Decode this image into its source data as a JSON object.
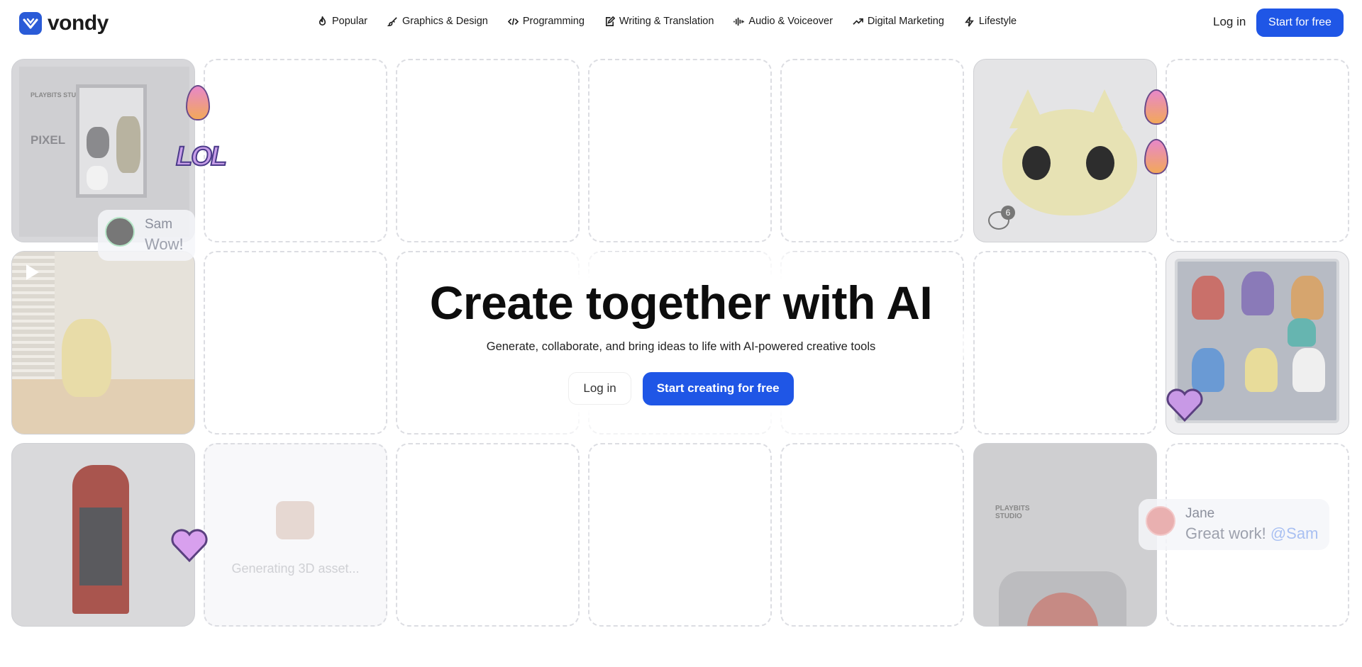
{
  "brand": {
    "name": "vondy",
    "accent": "#1f56e6"
  },
  "nav": [
    {
      "label": "Popular",
      "icon": "flame-icon"
    },
    {
      "label": "Graphics & Design",
      "icon": "brush-icon"
    },
    {
      "label": "Programming",
      "icon": "code-icon"
    },
    {
      "label": "Writing & Translation",
      "icon": "edit-icon"
    },
    {
      "label": "Audio & Voiceover",
      "icon": "waveform-icon"
    },
    {
      "label": "Digital Marketing",
      "icon": "trend-up-icon"
    },
    {
      "label": "Lifestyle",
      "icon": "bolt-icon"
    }
  ],
  "header": {
    "login": "Log in",
    "start": "Start for free"
  },
  "hero": {
    "title": "Create together with AI",
    "subtitle": "Generate, collaborate, and bring ideas to life with AI-powered creative tools",
    "login": "Log in",
    "start": "Start creating for free"
  },
  "cards": {
    "packaging_brand": "PLAYBITS STUDIO",
    "packaging_title": "PIXEL",
    "comment_count": "6",
    "generating": "Generating 3D asset...",
    "box_brand": "PLAYBITS STUDIO"
  },
  "chats": [
    {
      "name": "Sam",
      "message": "Wow!"
    },
    {
      "name": "Jane",
      "message": "Great work!",
      "mention": "@Sam"
    }
  ],
  "stickers": [
    "flame",
    "lol",
    "flame",
    "flame",
    "heart",
    "heart"
  ]
}
